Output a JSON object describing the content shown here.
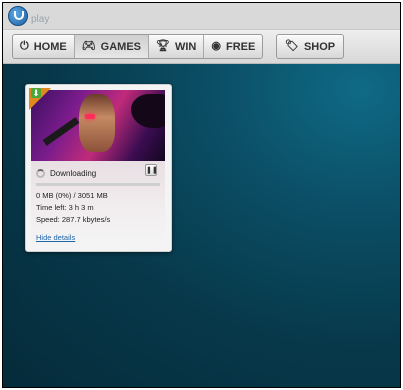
{
  "app": {
    "logo_text": "play"
  },
  "nav": {
    "home": "HOME",
    "games": "GAMES",
    "win": "WIN",
    "free": "FREE",
    "shop": "SHOP"
  },
  "game_card": {
    "status": "Downloading",
    "progress_fraction": 0.0,
    "size_line": "0 MB (0%) / 3051 MB",
    "time_left": "Time left: 3 h 3 m",
    "speed": "Speed: 287.7 kbytes/s",
    "hide_details": "Hide details"
  },
  "icons": {
    "home": "home-icon",
    "games": "gamepad-icon",
    "win": "trophy-icon",
    "free": "coin-icon",
    "shop": "tag-icon",
    "download_badge": "download-icon",
    "pause": "pause-icon"
  },
  "colors": {
    "background": "#07394b",
    "link": "#1f66a8",
    "badge": "#e08a1e"
  }
}
